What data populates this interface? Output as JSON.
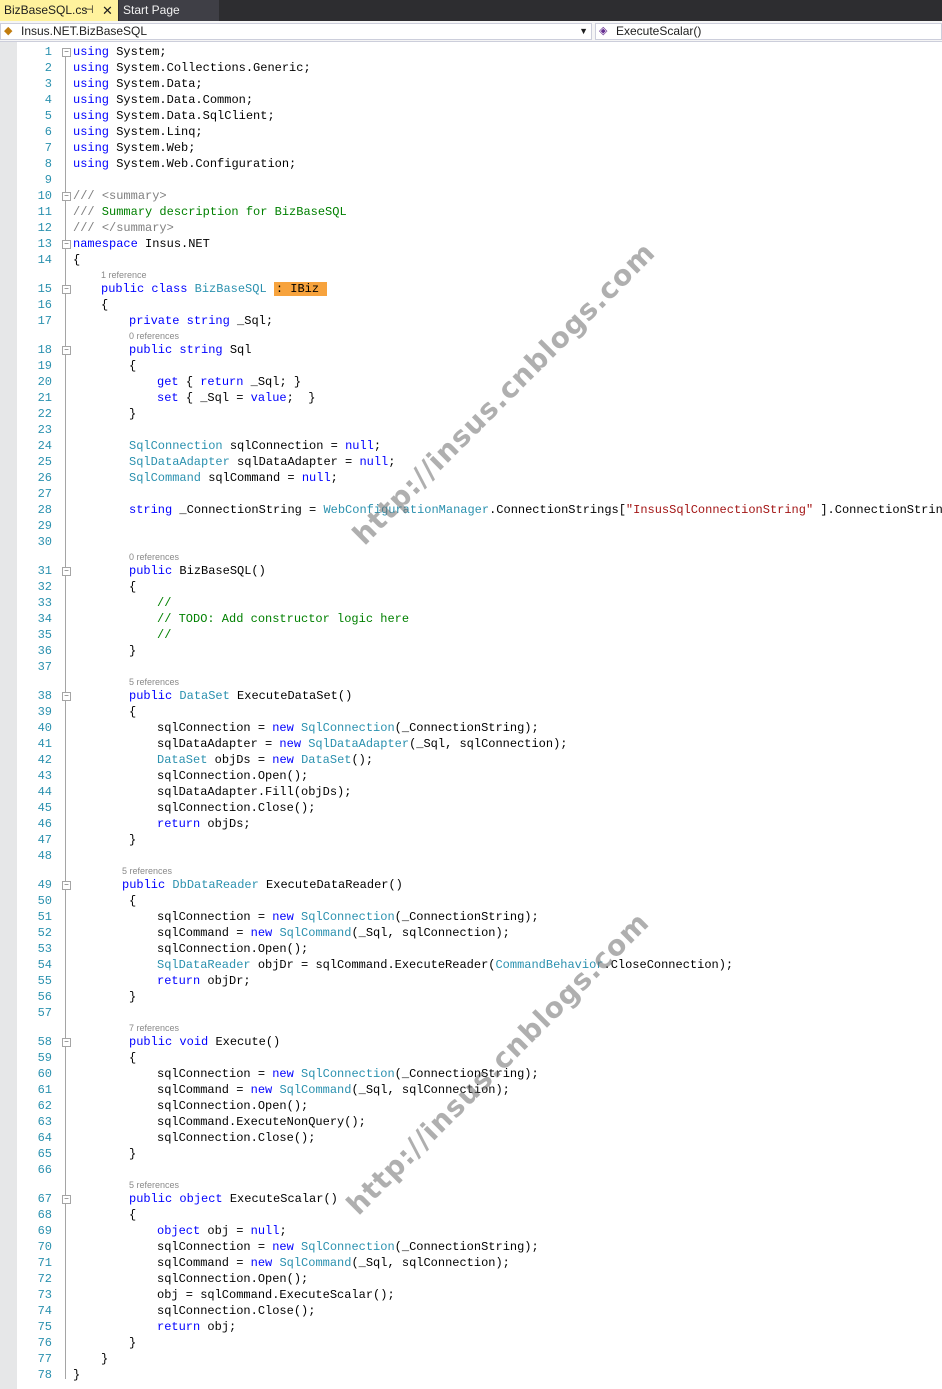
{
  "tabs": {
    "active_label": "BizBaseSQL.cs",
    "active_pin": "⊣",
    "active_close": "✕",
    "start_label": "Start Page"
  },
  "nav": {
    "type_scope": "Insus.NET.BizBaseSQL",
    "member_scope": "ExecuteScalar()"
  },
  "watermark": {
    "top": "http://insus.cnblogs.com",
    "bottom": "http://insus.cnblogs.com"
  },
  "colors": {
    "keyword": "#0000ff",
    "type": "#2b91af",
    "comment": "#008000",
    "string": "#a31515",
    "line_number": "#2b91af",
    "highlight": "#f7a33d",
    "active_tab": "#fff29d"
  },
  "editor": {
    "lines": [
      {
        "n": "1",
        "fold": "−",
        "code": [
          [
            "kw",
            "using"
          ],
          [
            "",
            "System;"
          ]
        ]
      },
      {
        "n": "2",
        "code": [
          [
            "kw",
            "using"
          ],
          [
            "",
            "System.Collections.Generic;"
          ]
        ]
      },
      {
        "n": "3",
        "code": [
          [
            "kw",
            "using"
          ],
          [
            "",
            "System.Data;"
          ]
        ]
      },
      {
        "n": "4",
        "code": [
          [
            "kw",
            "using"
          ],
          [
            "",
            "System.Data.Common;"
          ]
        ]
      },
      {
        "n": "5",
        "code": [
          [
            "kw",
            "using"
          ],
          [
            "",
            "System.Data.SqlClient;"
          ]
        ]
      },
      {
        "n": "6",
        "code": [
          [
            "kw",
            "using"
          ],
          [
            "",
            "System.Linq;"
          ]
        ]
      },
      {
        "n": "7",
        "code": [
          [
            "kw",
            "using"
          ],
          [
            "",
            "System.Web;"
          ]
        ]
      },
      {
        "n": "8",
        "code": [
          [
            "kw",
            "using"
          ],
          [
            "",
            "System.Web.Configuration;"
          ]
        ]
      },
      {
        "n": "9",
        "code": []
      },
      {
        "n": "10",
        "fold": "−",
        "code": [
          [
            "dc",
            "///"
          ],
          [
            "cm",
            " "
          ],
          [
            "dc",
            "<summary>"
          ]
        ]
      },
      {
        "n": "11",
        "code": [
          [
            "dc",
            "///"
          ],
          [
            "cm",
            " Summary description for BizBaseSQL"
          ]
        ]
      },
      {
        "n": "12",
        "code": [
          [
            "dc",
            "///"
          ],
          [
            "cm",
            " "
          ],
          [
            "dc",
            "</summary>"
          ]
        ]
      },
      {
        "n": "13",
        "fold": "−",
        "code": [
          [
            "kw",
            "namespace"
          ],
          [
            "",
            "Insus.NET"
          ]
        ]
      },
      {
        "n": "14",
        "code": [
          [
            "",
            "{"
          ]
        ]
      },
      {
        "n": "15",
        "fold": "−",
        "refs": "1 reference",
        "indent": 4,
        "code": [
          [
            "kw",
            "public"
          ],
          [
            "kw",
            "class"
          ],
          [
            "ty",
            "BizBaseSQL"
          ],
          [
            "hl",
            ": IBiz"
          ]
        ]
      },
      {
        "n": "16",
        "indent": 4,
        "code": [
          [
            "",
            "{"
          ]
        ]
      },
      {
        "n": "17",
        "indent": 8,
        "code": [
          [
            "kw",
            "private"
          ],
          [
            "kw",
            "string"
          ],
          [
            "",
            "_Sql;"
          ]
        ]
      },
      {
        "n": "18",
        "fold": "−",
        "refs": "0 references",
        "indent": 8,
        "code": [
          [
            "kw",
            "public"
          ],
          [
            "kw",
            "string"
          ],
          [
            "",
            "Sql"
          ]
        ]
      },
      {
        "n": "19",
        "indent": 8,
        "code": [
          [
            "",
            "{"
          ]
        ]
      },
      {
        "n": "20",
        "indent": 12,
        "code": [
          [
            "kw",
            "get"
          ],
          [
            "",
            "{"
          ],
          [
            "kw",
            "return"
          ],
          [
            "",
            "_Sql; }"
          ]
        ]
      },
      {
        "n": "21",
        "indent": 12,
        "code": [
          [
            "kw",
            "set"
          ],
          [
            "",
            "{ _Sql ="
          ],
          [
            "kw",
            "value"
          ],
          [
            "",
            ";  }"
          ]
        ]
      },
      {
        "n": "22",
        "indent": 8,
        "code": [
          [
            "",
            "}"
          ]
        ]
      },
      {
        "n": "23",
        "code": []
      },
      {
        "n": "24",
        "indent": 8,
        "code": [
          [
            "ty",
            "SqlConnection"
          ],
          [
            "",
            "sqlConnection ="
          ],
          [
            "kw",
            "null"
          ],
          [
            "",
            ";"
          ]
        ]
      },
      {
        "n": "25",
        "indent": 8,
        "code": [
          [
            "ty",
            "SqlDataAdapter"
          ],
          [
            "",
            "sqlDataAdapter ="
          ],
          [
            "kw",
            "null"
          ],
          [
            "",
            ";"
          ]
        ]
      },
      {
        "n": "26",
        "indent": 8,
        "code": [
          [
            "ty",
            "SqlCommand"
          ],
          [
            "",
            "sqlCommand ="
          ],
          [
            "kw",
            "null"
          ],
          [
            "",
            ";"
          ]
        ]
      },
      {
        "n": "27",
        "code": []
      },
      {
        "n": "28",
        "indent": 8,
        "code": [
          [
            "kw",
            "string"
          ],
          [
            "",
            "_ConnectionString ="
          ],
          [
            "ty",
            "WebConfigurationManager"
          ],
          [
            "",
            ".ConnectionStrings["
          ],
          [
            "st",
            "\"InsusSqlConnectionString\""
          ],
          [
            "",
            "].ConnectionString;"
          ]
        ]
      },
      {
        "n": "29",
        "code": []
      },
      {
        "n": "30",
        "code": []
      },
      {
        "n": "31",
        "fold": "−",
        "refs": "0 references",
        "indent": 8,
        "code": [
          [
            "kw",
            "public"
          ],
          [
            "",
            "BizBaseSQL()"
          ]
        ]
      },
      {
        "n": "32",
        "indent": 8,
        "code": [
          [
            "",
            "{"
          ]
        ]
      },
      {
        "n": "33",
        "indent": 12,
        "code": [
          [
            "cm",
            "//"
          ]
        ]
      },
      {
        "n": "34",
        "indent": 12,
        "code": [
          [
            "cm",
            "// TODO: Add constructor logic here"
          ]
        ]
      },
      {
        "n": "35",
        "indent": 12,
        "code": [
          [
            "cm",
            "//"
          ]
        ]
      },
      {
        "n": "36",
        "indent": 8,
        "code": [
          [
            "",
            "}"
          ]
        ]
      },
      {
        "n": "37",
        "code": []
      },
      {
        "n": "38",
        "fold": "−",
        "refs": "5 references",
        "indent": 8,
        "code": [
          [
            "kw",
            "public"
          ],
          [
            "ty",
            "DataSet"
          ],
          [
            "",
            "ExecuteDataSet()"
          ]
        ]
      },
      {
        "n": "39",
        "indent": 8,
        "code": [
          [
            "",
            "{"
          ]
        ]
      },
      {
        "n": "40",
        "indent": 12,
        "code": [
          [
            "",
            "sqlConnection ="
          ],
          [
            "kw",
            "new"
          ],
          [
            "ty",
            "SqlConnection"
          ],
          [
            "",
            "(_ConnectionString);"
          ]
        ]
      },
      {
        "n": "41",
        "indent": 12,
        "code": [
          [
            "",
            "sqlDataAdapter ="
          ],
          [
            "kw",
            "new"
          ],
          [
            "ty",
            "SqlDataAdapter"
          ],
          [
            "",
            "(_Sql, sqlConnection);"
          ]
        ]
      },
      {
        "n": "42",
        "indent": 12,
        "code": [
          [
            "ty",
            "DataSet"
          ],
          [
            "",
            "objDs ="
          ],
          [
            "kw",
            "new"
          ],
          [
            "ty",
            "DataSet"
          ],
          [
            "",
            "();"
          ]
        ]
      },
      {
        "n": "43",
        "indent": 12,
        "code": [
          [
            "",
            "sqlConnection.Open();"
          ]
        ]
      },
      {
        "n": "44",
        "indent": 12,
        "code": [
          [
            "",
            "sqlDataAdapter.Fill(objDs);"
          ]
        ]
      },
      {
        "n": "45",
        "indent": 12,
        "code": [
          [
            "",
            "sqlConnection.Close();"
          ]
        ]
      },
      {
        "n": "46",
        "indent": 12,
        "code": [
          [
            "kw",
            "return"
          ],
          [
            "",
            "objDs;"
          ]
        ]
      },
      {
        "n": "47",
        "indent": 8,
        "code": [
          [
            "",
            "}"
          ]
        ]
      },
      {
        "n": "48",
        "code": []
      },
      {
        "n": "49",
        "fold": "−",
        "refs": "5 references",
        "indent": 7,
        "code": [
          [
            "kw",
            "public"
          ],
          [
            "ty",
            "DbDataReader"
          ],
          [
            "",
            "ExecuteDataReader()"
          ]
        ]
      },
      {
        "n": "50",
        "indent": 8,
        "code": [
          [
            "",
            "{"
          ]
        ]
      },
      {
        "n": "51",
        "indent": 12,
        "code": [
          [
            "",
            "sqlConnection ="
          ],
          [
            "kw",
            "new"
          ],
          [
            "ty",
            "SqlConnection"
          ],
          [
            "",
            "(_ConnectionString);"
          ]
        ]
      },
      {
        "n": "52",
        "indent": 12,
        "code": [
          [
            "",
            "sqlCommand ="
          ],
          [
            "kw",
            "new"
          ],
          [
            "ty",
            "SqlCommand"
          ],
          [
            "",
            "(_Sql, sqlConnection);"
          ]
        ]
      },
      {
        "n": "53",
        "indent": 12,
        "code": [
          [
            "",
            "sqlConnection.Open();"
          ]
        ]
      },
      {
        "n": "54",
        "indent": 12,
        "code": [
          [
            "ty",
            "SqlDataReader"
          ],
          [
            "",
            "objDr = sqlCommand.ExecuteReader("
          ],
          [
            "ty",
            "CommandBehavior"
          ],
          [
            "",
            ".CloseConnection);"
          ]
        ]
      },
      {
        "n": "55",
        "indent": 12,
        "code": [
          [
            "kw",
            "return"
          ],
          [
            "",
            "objDr;"
          ]
        ]
      },
      {
        "n": "56",
        "indent": 8,
        "code": [
          [
            "",
            "}"
          ]
        ]
      },
      {
        "n": "57",
        "code": []
      },
      {
        "n": "58",
        "fold": "−",
        "refs": "7 references",
        "indent": 8,
        "code": [
          [
            "kw",
            "public"
          ],
          [
            "kw",
            "void"
          ],
          [
            "",
            "Execute()"
          ]
        ]
      },
      {
        "n": "59",
        "indent": 8,
        "code": [
          [
            "",
            "{"
          ]
        ]
      },
      {
        "n": "60",
        "indent": 12,
        "code": [
          [
            "",
            "sqlConnection ="
          ],
          [
            "kw",
            "new"
          ],
          [
            "ty",
            "SqlConnection"
          ],
          [
            "",
            "(_ConnectionString);"
          ]
        ]
      },
      {
        "n": "61",
        "indent": 12,
        "code": [
          [
            "",
            "sqlCommand ="
          ],
          [
            "kw",
            "new"
          ],
          [
            "ty",
            "SqlCommand"
          ],
          [
            "",
            "(_Sql, sqlConnection);"
          ]
        ]
      },
      {
        "n": "62",
        "indent": 12,
        "code": [
          [
            "",
            "sqlConnection.Open();"
          ]
        ]
      },
      {
        "n": "63",
        "indent": 12,
        "code": [
          [
            "",
            "sqlCommand.ExecuteNonQuery();"
          ]
        ]
      },
      {
        "n": "64",
        "indent": 12,
        "code": [
          [
            "",
            "sqlConnection.Close();"
          ]
        ]
      },
      {
        "n": "65",
        "indent": 8,
        "code": [
          [
            "",
            "}"
          ]
        ]
      },
      {
        "n": "66",
        "code": []
      },
      {
        "n": "67",
        "fold": "−",
        "refs": "5 references",
        "indent": 8,
        "code": [
          [
            "kw",
            "public"
          ],
          [
            "kw",
            "object"
          ],
          [
            "",
            "ExecuteScalar()"
          ]
        ]
      },
      {
        "n": "68",
        "indent": 8,
        "code": [
          [
            "",
            "{"
          ]
        ]
      },
      {
        "n": "69",
        "indent": 12,
        "code": [
          [
            "kw",
            "object"
          ],
          [
            "",
            "obj ="
          ],
          [
            "kw",
            "null"
          ],
          [
            "",
            ";"
          ]
        ]
      },
      {
        "n": "70",
        "indent": 12,
        "code": [
          [
            "",
            "sqlConnection ="
          ],
          [
            "kw",
            "new"
          ],
          [
            "ty",
            "SqlConnection"
          ],
          [
            "",
            "(_ConnectionString);"
          ]
        ]
      },
      {
        "n": "71",
        "indent": 12,
        "code": [
          [
            "",
            "sqlCommand ="
          ],
          [
            "kw",
            "new"
          ],
          [
            "ty",
            "SqlCommand"
          ],
          [
            "",
            "(_Sql, sqlConnection);"
          ]
        ]
      },
      {
        "n": "72",
        "indent": 12,
        "code": [
          [
            "",
            "sqlConnection.Open();"
          ]
        ]
      },
      {
        "n": "73",
        "indent": 12,
        "code": [
          [
            "",
            "obj = sqlCommand.ExecuteScalar();"
          ]
        ]
      },
      {
        "n": "74",
        "indent": 12,
        "code": [
          [
            "",
            "sqlConnection.Close();"
          ]
        ]
      },
      {
        "n": "75",
        "indent": 12,
        "code": [
          [
            "kw",
            "return"
          ],
          [
            "",
            "obj;"
          ]
        ]
      },
      {
        "n": "76",
        "indent": 8,
        "code": [
          [
            "",
            "}"
          ]
        ]
      },
      {
        "n": "77",
        "indent": 4,
        "code": [
          [
            "",
            "}"
          ]
        ]
      },
      {
        "n": "78",
        "code": [
          [
            "",
            "}"
          ]
        ]
      }
    ]
  }
}
